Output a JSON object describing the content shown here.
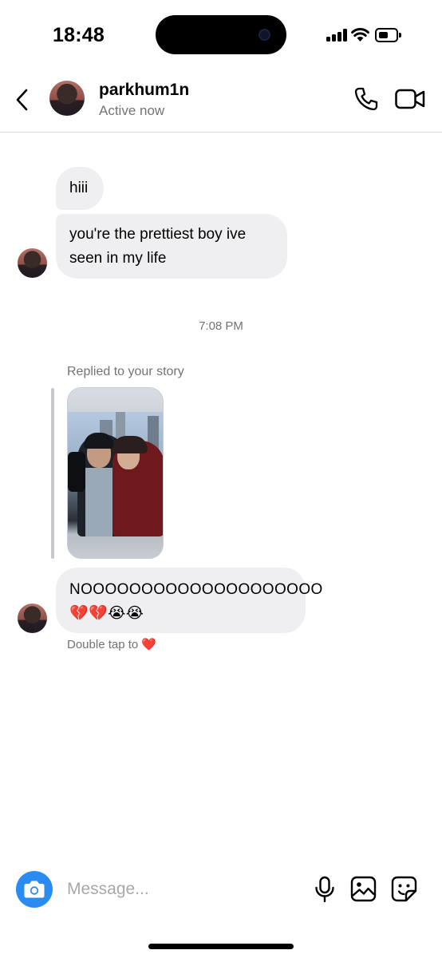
{
  "status_bar": {
    "time": "18:48"
  },
  "header": {
    "username": "parkhum1n",
    "presence": "Active now"
  },
  "messages": [
    {
      "text": "hiii"
    },
    {
      "text": "you're the prettiest boy ive seen in my life"
    }
  ],
  "timestamp": "7:08 PM",
  "story_reply": {
    "caption": "Replied to your story",
    "message": "NOOOOOOOOOOOOOOOOOOOO 💔💔😭😭",
    "hint": "Double tap to",
    "hint_emoji": "❤️"
  },
  "composer": {
    "placeholder": "Message..."
  },
  "icons": {
    "back": "chevron-left-icon",
    "call": "phone-icon",
    "video": "video-camera-icon",
    "camera": "camera-icon",
    "mic": "microphone-icon",
    "gallery": "image-icon",
    "sticker": "sticker-icon"
  },
  "colors": {
    "bubble": "#efeff1",
    "secondary_text": "#737373",
    "camera_button": "#2a8cf0",
    "heart": "#ed2d3d"
  }
}
